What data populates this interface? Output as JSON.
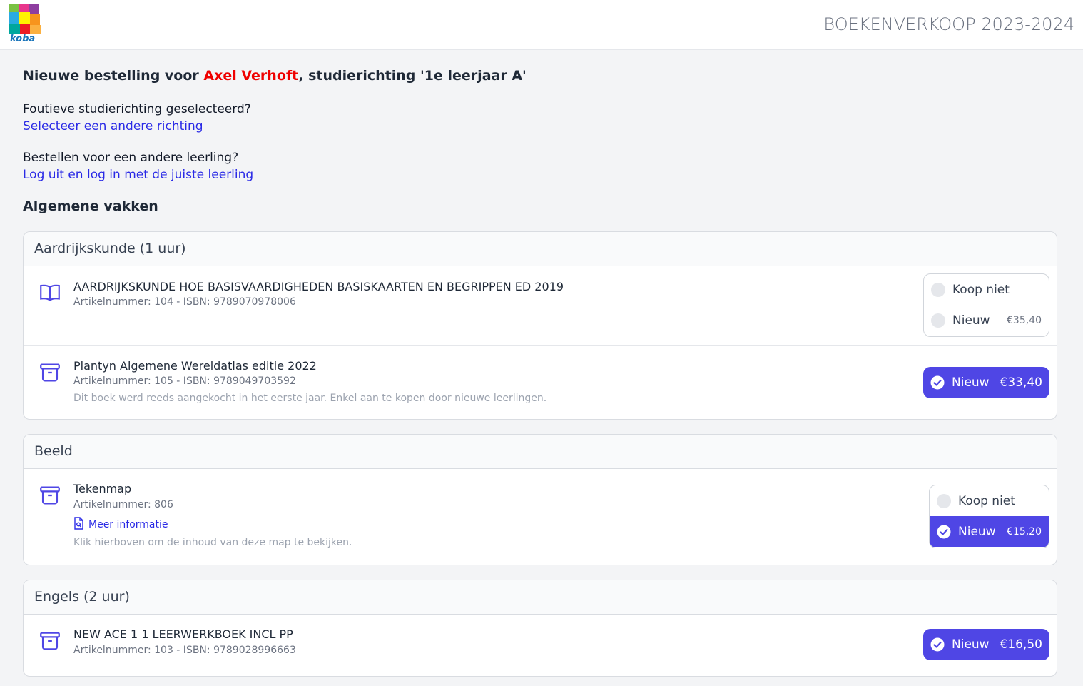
{
  "header": {
    "logo_text": "koba",
    "title": "BOEKENVERKOOP 2023-2024"
  },
  "intro": {
    "heading_prefix": "Nieuwe bestelling voor ",
    "student_name": "Axel Verhoft",
    "heading_suffix": ", studierichting '1e leerjaar A'",
    "wrong_direction_question": "Foutieve studierichting geselecteerd?",
    "wrong_direction_link": "Selecteer een andere richting",
    "other_student_question": "Bestellen voor een andere leerling?",
    "other_student_link": "Log uit en log in met de juiste leerling"
  },
  "section_title": "Algemene vakken",
  "courses": [
    {
      "title": "Aardrijkskunde (1 uur)",
      "items": [
        {
          "icon": "book-icon",
          "title": "AARDRIJKSKUNDE HOE BASISVAARDIGHEDEN BASISKAARTEN EN BEGRIPPEN ED 2019",
          "sub": "Artikelnummer: 104 - ISBN: 9789070978006",
          "options": [
            {
              "label": "Koop niet",
              "price": "",
              "selected": false
            },
            {
              "label": "Nieuw",
              "price": "€35,40",
              "selected": false
            }
          ]
        },
        {
          "icon": "archive-box-icon",
          "title": "Plantyn Algemene Wereldatlas editie 2022",
          "sub": "Artikelnummer: 105 - ISBN: 9789049703592",
          "note": "Dit boek werd reeds aangekocht in het eerste jaar. Enkel aan te kopen door nieuwe leerlingen.",
          "pill": {
            "label": "Nieuw",
            "price": "€33,40"
          }
        }
      ]
    },
    {
      "title": "Beeld",
      "items": [
        {
          "icon": "archive-box-icon",
          "title": "Tekenmap",
          "sub": "Artikelnummer: 806",
          "link": "Meer informatie",
          "note": "Klik hierboven om de inhoud van deze map te bekijken.",
          "options": [
            {
              "label": "Koop niet",
              "price": "",
              "selected": false
            },
            {
              "label": "Nieuw",
              "price": "€15,20",
              "selected": true
            }
          ]
        }
      ]
    },
    {
      "title": "Engels (2 uur)",
      "items": [
        {
          "icon": "archive-box-icon",
          "title": "NEW ACE 1 1 LEERWERKBOEK INCL PP",
          "sub": "Artikelnummer: 103 - ISBN: 9789028996663",
          "pill": {
            "label": "Nieuw",
            "price": "€16,50"
          }
        }
      ]
    }
  ],
  "colors": {
    "accent": "#4f46e5",
    "link": "#2a2ae6",
    "student_name": "#ef0000"
  }
}
